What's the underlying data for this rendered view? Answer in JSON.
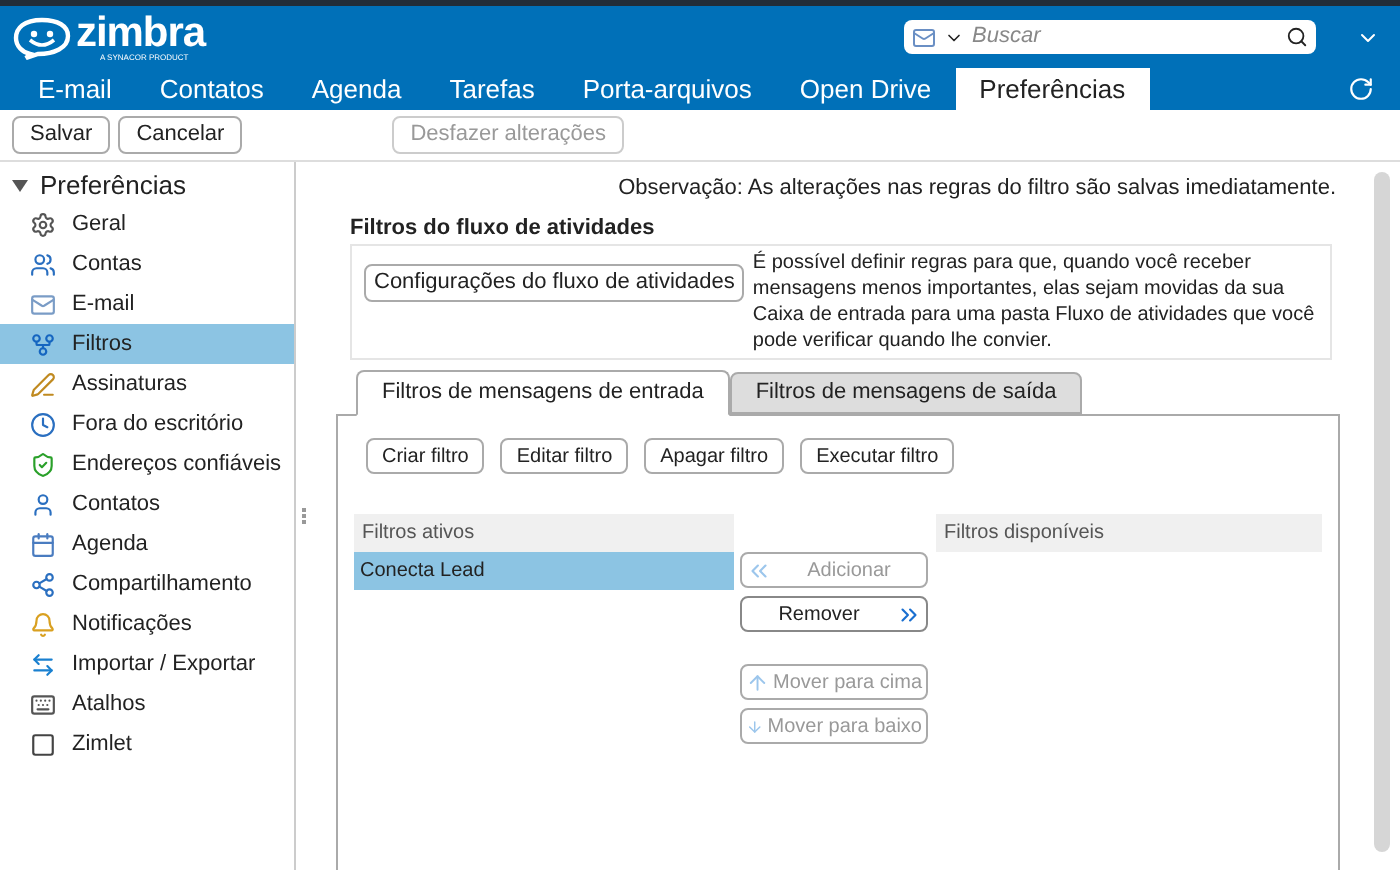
{
  "header": {
    "logo_text": "zimbra",
    "logo_tagline": "A SYNACOR PRODUCT",
    "search": {
      "placeholder": "Buscar"
    }
  },
  "app_tabs": [
    {
      "label": "E-mail",
      "selected": false
    },
    {
      "label": "Contatos",
      "selected": false
    },
    {
      "label": "Agenda",
      "selected": false
    },
    {
      "label": "Tarefas",
      "selected": false
    },
    {
      "label": "Porta-arquivos",
      "selected": false
    },
    {
      "label": "Open Drive",
      "selected": false
    },
    {
      "label": "Preferências",
      "selected": true
    }
  ],
  "toolbar": [
    {
      "label": "Salvar",
      "disabled": false
    },
    {
      "label": "Cancelar",
      "disabled": false
    },
    {
      "label": "Desfazer alterações",
      "disabled": true
    }
  ],
  "sidebar": {
    "title": "Preferências",
    "expanded": true,
    "items": [
      {
        "label": "Geral",
        "selected": false
      },
      {
        "label": "Contas",
        "selected": false
      },
      {
        "label": "E-mail",
        "selected": false
      },
      {
        "label": "Filtros",
        "selected": true
      },
      {
        "label": "Assinaturas",
        "selected": false
      },
      {
        "label": "Fora do escritório",
        "selected": false
      },
      {
        "label": "Endereços confiáveis",
        "selected": false
      },
      {
        "label": "Contatos",
        "selected": false
      },
      {
        "label": "Agenda",
        "selected": false
      },
      {
        "label": "Compartilhamento",
        "selected": false
      },
      {
        "label": "Notificações",
        "selected": false
      },
      {
        "label": "Importar / Exportar",
        "selected": false
      },
      {
        "label": "Atalhos",
        "selected": false
      },
      {
        "label": "Zimlet",
        "selected": false
      }
    ]
  },
  "note": "Observação: As alterações nas regras do filtro são salvas imediatamente.",
  "activity_stream": {
    "title": "Filtros do fluxo de atividades",
    "button": "Configurações do fluxo de atividades",
    "description": "É possível definir regras para que, quando você receber mensagens menos importantes, elas sejam movidas da sua Caixa de entrada para uma pasta Fluxo de atividades que você pode verificar quando lhe convier."
  },
  "filter_tabs": [
    {
      "label": "Filtros de mensagens de entrada",
      "selected": true
    },
    {
      "label": "Filtros de mensagens de saída",
      "selected": false
    }
  ],
  "filter_actions": [
    {
      "label": "Criar filtro"
    },
    {
      "label": "Editar filtro"
    },
    {
      "label": "Apagar filtro"
    },
    {
      "label": "Executar filtro"
    }
  ],
  "active_filters": {
    "title": "Filtros ativos",
    "rows": [
      {
        "label": "Conecta Lead",
        "selected": true
      }
    ]
  },
  "move_buttons": [
    {
      "label": "Adicionar",
      "kind": "add",
      "disabled": true
    },
    {
      "label": "Remover",
      "kind": "remove",
      "disabled": false
    },
    {
      "label": "Mover para cima",
      "kind": "up",
      "disabled": true
    },
    {
      "label": "Mover para baixo",
      "kind": "down",
      "disabled": true
    }
  ],
  "available_filters": {
    "title": "Filtros disponíveis"
  }
}
